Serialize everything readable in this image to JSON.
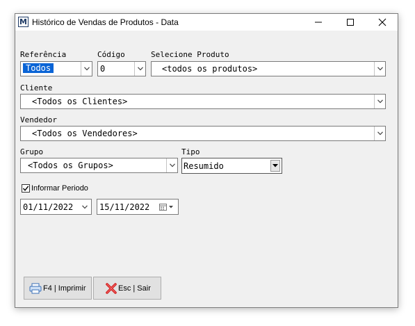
{
  "window": {
    "title": "Histórico de Vendas de Produtos - Data",
    "app_icon_letter": "M"
  },
  "labels": {
    "referencia": "Referência",
    "codigo": "Código",
    "selecione_produto": "Selecione Produto",
    "cliente": "Cliente",
    "vendedor": "Vendedor",
    "grupo": "Grupo",
    "tipo": "Tipo"
  },
  "fields": {
    "referencia": "Todos",
    "codigo": "0",
    "produto": "<todos os produtos>",
    "cliente": "<Todos os Clientes>",
    "vendedor": "<Todos os Vendedores>",
    "grupo": "<Todos os Grupos>",
    "tipo": "Resumido"
  },
  "periodo": {
    "label": "Informar Periodo",
    "checked": true,
    "data_inicio": "01/11/2022",
    "data_fim": "15/11/2022"
  },
  "buttons": {
    "imprimir": "F4 | Imprimir",
    "sair": "Esc | Sair"
  },
  "icons": [
    "app-icon",
    "minimize-icon",
    "maximize-icon",
    "close-icon",
    "chevron-down-icon",
    "calendar-icon",
    "printer-icon",
    "exit-x-icon"
  ],
  "colors": {
    "selection": "#0a64d6",
    "exit_icon": "#d42020"
  }
}
